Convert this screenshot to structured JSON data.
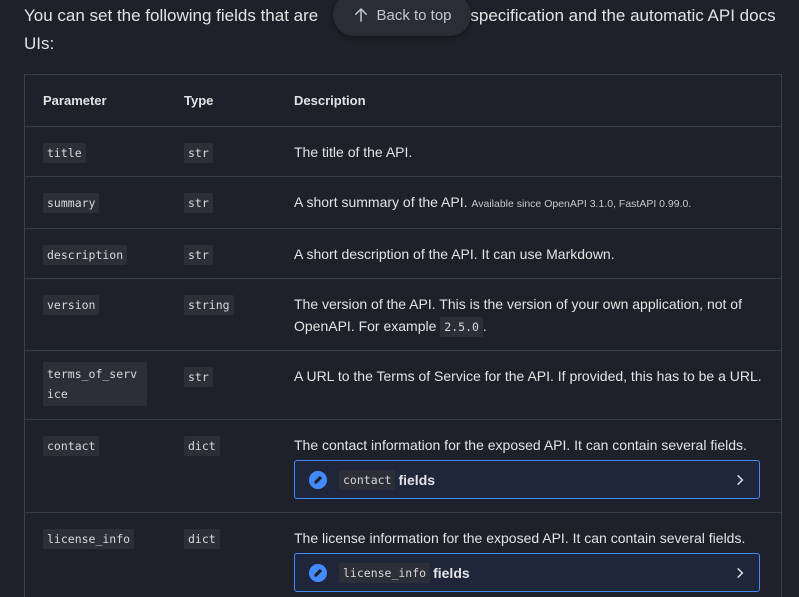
{
  "intro": {
    "text_start": "You can set the following fields that are",
    "text_end": "API specification and the automatic API docs UIs:"
  },
  "back_to_top": {
    "label": "Back to top"
  },
  "table": {
    "headers": [
      "Parameter",
      "Type",
      "Description"
    ],
    "rows": [
      {
        "param": "title",
        "type": "str",
        "desc": "The title of the API."
      },
      {
        "param": "summary",
        "type": "str",
        "desc": "A short summary of the API.",
        "note": "Available since OpenAPI 3.1.0, FastAPI 0.99.0."
      },
      {
        "param": "description",
        "type": "str",
        "desc": "A short description of the API. It can use Markdown."
      },
      {
        "param": "version",
        "type": "string",
        "desc": "The version of the API. This is the version of your own application, not of OpenAPI. For example",
        "example": "2.5.0",
        "desc_end": "."
      },
      {
        "param": "terms_of_service",
        "type": "str",
        "desc": "A URL to the Terms of Service for the API. If provided, this has to be a URL."
      },
      {
        "param": "contact",
        "type": "dict",
        "desc": "The contact information for the exposed API. It can contain several fields.",
        "expander_code": "contact",
        "expander_label": "fields"
      },
      {
        "param": "license_info",
        "type": "dict",
        "desc": "The license information for the exposed API. It can contain several fields.",
        "expander_code": "license_info",
        "expander_label": "fields"
      }
    ]
  },
  "icons": {
    "back_to_top": "arrow-up-icon",
    "admonition": "pencil-icon",
    "expand": "chevron-right-icon"
  },
  "colors": {
    "background": "#1e2129",
    "accent": "#448aff",
    "border": "#3b3f4a"
  }
}
